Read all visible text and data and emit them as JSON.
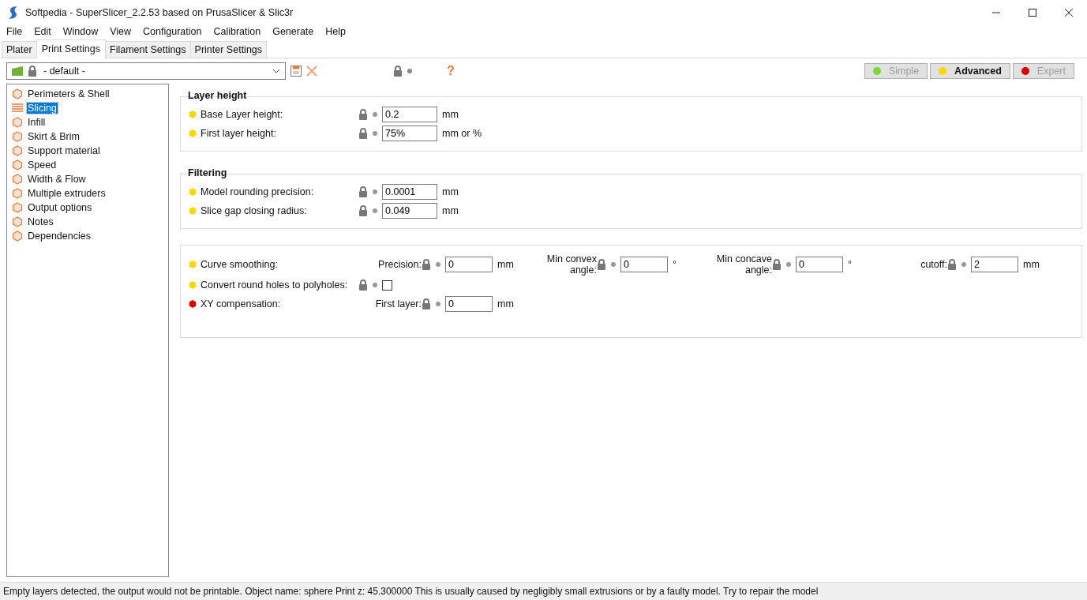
{
  "window": {
    "title": "Softpedia - SuperSlicer_2.2.53 based on PrusaSlicer & Slic3r"
  },
  "menu": [
    "File",
    "Edit",
    "Window",
    "View",
    "Configuration",
    "Calibration",
    "Generate",
    "Help"
  ],
  "tabs": [
    {
      "label": "Plater",
      "selected": false
    },
    {
      "label": "Print Settings",
      "selected": true
    },
    {
      "label": "Filament Settings",
      "selected": false
    },
    {
      "label": "Printer Settings",
      "selected": false
    }
  ],
  "preset": {
    "value": "- default -",
    "help": "?"
  },
  "modes": [
    {
      "label": "Simple",
      "color": "#7bd836",
      "selected": false
    },
    {
      "label": "Advanced",
      "color": "#ffd700",
      "selected": true
    },
    {
      "label": "Expert",
      "color": "#e00000",
      "selected": false
    }
  ],
  "sidebar": {
    "items": [
      {
        "label": "Perimeters & Shell",
        "selected": false
      },
      {
        "label": "Slicing",
        "selected": true
      },
      {
        "label": "Infill",
        "selected": false
      },
      {
        "label": "Skirt & Brim",
        "selected": false
      },
      {
        "label": "Support material",
        "selected": false
      },
      {
        "label": "Speed",
        "selected": false
      },
      {
        "label": "Width & Flow",
        "selected": false
      },
      {
        "label": "Multiple extruders",
        "selected": false
      },
      {
        "label": "Output options",
        "selected": false
      },
      {
        "label": "Notes",
        "selected": false
      },
      {
        "label": "Dependencies",
        "selected": false
      }
    ]
  },
  "groups": [
    {
      "title": "Layer height",
      "rows": [
        {
          "kind": "field",
          "label": "Base Layer height:",
          "color": "#ffd700",
          "value": "0.2",
          "unit": "mm"
        },
        {
          "kind": "field",
          "label": "First layer height:",
          "color": "#ffd700",
          "value": "75%",
          "unit": "mm or %"
        }
      ]
    },
    {
      "title": "Filtering",
      "rows": [
        {
          "kind": "field",
          "label": "Model rounding precision:",
          "color": "#ffd700",
          "value": "0.0001",
          "unit": "mm"
        },
        {
          "kind": "field",
          "label": "Slice gap closing radius:",
          "color": "#ffd700",
          "value": "0.049",
          "unit": "mm"
        }
      ]
    },
    {
      "rows": [
        {
          "kind": "multi",
          "label": "Curve smoothing:",
          "color": "#ffd700",
          "fields": [
            {
              "label": "Precision:",
              "value": "0",
              "unit": "mm"
            },
            {
              "label": "Min convex angle:",
              "value": "0",
              "unit": "°"
            },
            {
              "label": "Min concave angle:",
              "value": "0",
              "unit": "°"
            },
            {
              "label": "cutoff:",
              "value": "2",
              "unit": "mm"
            }
          ]
        },
        {
          "kind": "checkbox",
          "label": "Convert round holes to polyholes:",
          "color": "#ffd700",
          "checked": false
        },
        {
          "kind": "multi",
          "label": "XY compensation:",
          "color": "#e00000",
          "fields": [
            {
              "label": "First layer:",
              "value": "0",
              "unit": "mm"
            }
          ]
        }
      ]
    }
  ],
  "status_bar": "Empty layers detected, the output would not be printable.  Object name: sphere Print z: 45.300000  This is usually caused by negligibly small extrusions or by a faulty model. Try to repair the model"
}
